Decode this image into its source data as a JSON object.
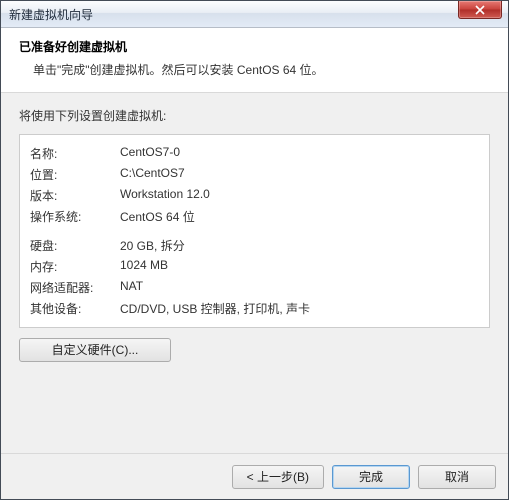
{
  "window": {
    "title": "新建虚拟机向导"
  },
  "header": {
    "title": "已准备好创建虚拟机",
    "subtitle": "单击\"完成\"创建虚拟机。然后可以安装 CentOS 64 位。"
  },
  "lead": "将使用下列设置创建虚拟机:",
  "settings": {
    "name_k": "名称:",
    "name_v": "CentOS7-0",
    "location_k": "位置:",
    "location_v": "C:\\CentOS7",
    "version_k": "版本:",
    "version_v": "Workstation 12.0",
    "os_k": "操作系统:",
    "os_v": "CentOS 64 位",
    "disk_k": "硬盘:",
    "disk_v": "20 GB, 拆分",
    "memory_k": "内存:",
    "memory_v": "1024 MB",
    "network_k": "网络适配器:",
    "network_v": "NAT",
    "other_k": "其他设备:",
    "other_v": "CD/DVD, USB 控制器, 打印机, 声卡"
  },
  "buttons": {
    "customize": "自定义硬件(C)...",
    "back": "< 上一步(B)",
    "finish": "完成",
    "cancel": "取消"
  }
}
